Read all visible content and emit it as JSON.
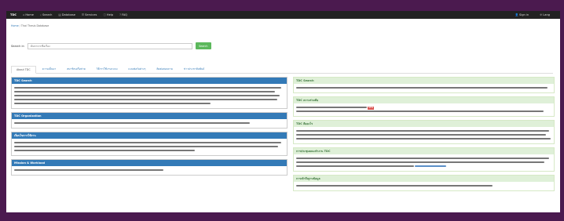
{
  "navbar": {
    "brand": "TDC",
    "items": [
      {
        "label": "Home",
        "icon": "home-icon"
      },
      {
        "label": "Search",
        "icon": "search-icon"
      },
      {
        "label": "Database",
        "icon": "database-icon"
      },
      {
        "label": "Services",
        "icon": "list-icon"
      },
      {
        "label": "Help",
        "icon": "info-icon"
      },
      {
        "label": "FAQ",
        "icon": "question-icon"
      }
    ],
    "right": [
      {
        "label": "Sign in",
        "icon": "user-icon"
      },
      {
        "label": "Lang",
        "icon": "globe-icon"
      }
    ]
  },
  "breadcrumb": {
    "home": "Home",
    "current": "Thai Thesis Database"
  },
  "search": {
    "label": "Search in",
    "placeholder": "ค้นหาจากชื่อเรื่อง",
    "button": "Search"
  },
  "tabs": [
    {
      "label": "About TDC",
      "active": true
    },
    {
      "label": "ความเป็นมา",
      "active": false
    },
    {
      "label": "สมาชิกเครือข่าย",
      "active": false
    },
    {
      "label": "วิธีการใช้งานระบบ",
      "active": false
    },
    {
      "label": "แบบฟอร์มต่างๆ",
      "active": false
    },
    {
      "label": "ติดต่อสอบถาม",
      "active": false
    },
    {
      "label": "ข่าวประชาสัมพันธ์",
      "active": false
    }
  ],
  "left_panels": [
    {
      "title": "TDC Search"
    },
    {
      "title": "TDC Organization"
    },
    {
      "title": "เงื่อนไขการใช้งาน"
    },
    {
      "title": "Mission & Workload"
    }
  ],
  "right_panels": [
    {
      "title": "TDC Search"
    },
    {
      "title": "TDC ความร่วมมือ",
      "new_badge": "NEW"
    },
    {
      "title": "TDC คืออะไร"
    },
    {
      "title": "การประชุมคณะทำงาน TDC"
    },
    {
      "title": "การเข้าถึงฐานข้อมูล"
    }
  ],
  "colors": {
    "navbar": "#222222",
    "panel_header_left": "#337ab7",
    "panel_header_right": "#dff0d8",
    "accent_button": "#5cb85c",
    "frame": "#4b1a4f"
  }
}
